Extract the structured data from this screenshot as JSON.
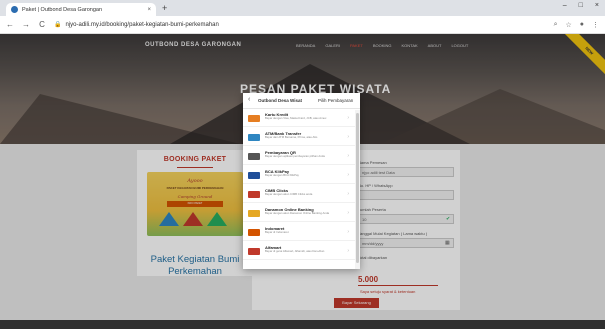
{
  "browser": {
    "tab_title": "Paket | Outbond Desa Garongan",
    "tab_close": "×",
    "new_tab": "+",
    "url": "njyo-adili.my.id/booking/paket-kegiatan-bumi-perkemahan",
    "window_controls": [
      "–",
      "□",
      "×"
    ],
    "nav": {
      "back": "←",
      "forward": "→",
      "reload": "C"
    }
  },
  "site": {
    "brand": "OUTBOND DESA GARONGAN",
    "nav": [
      "BERANDA",
      "GALERI",
      "PAKET",
      "BOOKING",
      "KONTAK",
      "ABOUT",
      "LOGOUT"
    ],
    "active_nav_index": 2,
    "hero_title": "PESAN PAKET WISATA",
    "ribbon": "NEW"
  },
  "booking": {
    "title": "BOOKING PAKET",
    "poster_script": "Ayooo",
    "poster_text": "PAKET KEGIATAN BUMI PERKEMAHAN",
    "poster_sub": "Camping Ground",
    "poster_badge": "INFO PAKET",
    "package_name": "Paket Kegiatan Bumi Perkemahan"
  },
  "form": {
    "name_label": "Nama Pemesan",
    "name_value": "njyo adili test Data",
    "phone_label": "No. HP / WhatsApp",
    "people_label": "Jumlah Peserta",
    "people_value": "10",
    "date_label": "Tanggal Mulai Kegiatan  ( Lama waktu )",
    "date_value": "mm/dd/yyyy",
    "total_label": "Total dibayarkan",
    "total_value": "5.000",
    "agree_text": "Saya setuju syarat & ketentuan",
    "submit_label": "Bayar Sekarang"
  },
  "modal": {
    "back": "‹",
    "shop": "Outbond Desa Wisat",
    "pick": "Pilih Pembayaran",
    "chevron": "›",
    "payments": [
      {
        "name": "Kartu Kredit",
        "desc": "Bayar dengan Visa, MasterCard, JCB, atau Amex",
        "color": "#e67e22"
      },
      {
        "name": "ATM/Bank Transfer",
        "desc": "Bayar dari ATM Bersama, Prima, atau Alto",
        "color": "#2e86c1"
      },
      {
        "name": "Pembayaran QR",
        "desc": "Bayar dengan aplikasi pembayaran pilihan Anda",
        "color": "#555555"
      },
      {
        "name": "BCA KlikPay",
        "desc": "Bayar dengan BCA KlikPay",
        "color": "#1f4e99"
      },
      {
        "name": "CIMB Clicks",
        "desc": "Bayar dengan akun CIMB Clicks anda",
        "color": "#c0392b"
      },
      {
        "name": "Danamon Online Banking",
        "desc": "Bayar dengan akun Danamon Online Banking Anda",
        "color": "#e5a823"
      },
      {
        "name": "Indomaret",
        "desc": "Bayar di Indomaret",
        "color": "#d35400"
      },
      {
        "name": "Alfamart",
        "desc": "Bayar di gerai Alfamart, Alfamidi, atau Dan+Dan",
        "color": "#c0392b"
      }
    ]
  }
}
